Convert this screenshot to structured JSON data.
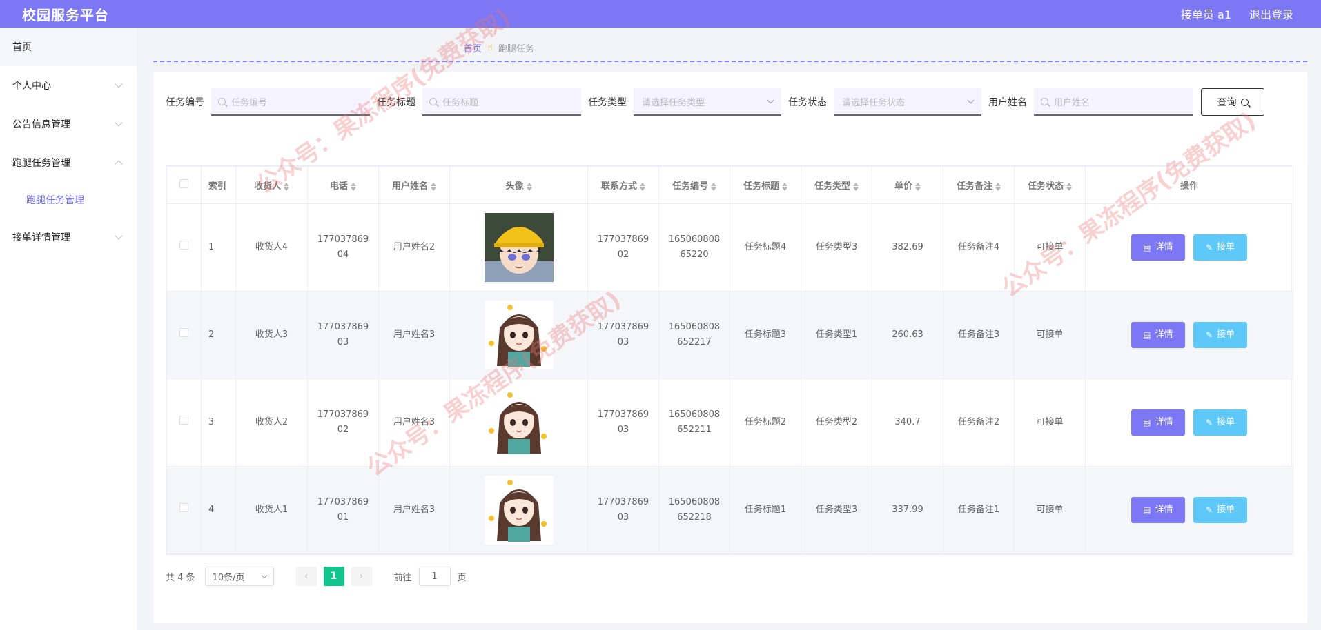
{
  "header": {
    "brand": "校园服务平台",
    "user_label": "接单员 a1",
    "logout": "退出登录"
  },
  "sidebar": {
    "items": [
      {
        "label": "首页"
      },
      {
        "label": "个人中心"
      },
      {
        "label": "公告信息管理"
      },
      {
        "label": "跑腿任务管理"
      },
      {
        "label": "跑腿任务管理"
      },
      {
        "label": "接单详情管理"
      }
    ]
  },
  "breadcrumb": {
    "home": "首页",
    "current": "跑腿任务"
  },
  "search": {
    "task_no_label": "任务编号",
    "task_no_placeholder": "任务编号",
    "task_title_label": "任务标题",
    "task_title_placeholder": "任务标题",
    "task_type_label": "任务类型",
    "task_type_placeholder": "请选择任务类型",
    "task_status_label": "任务状态",
    "task_status_placeholder": "请选择任务状态",
    "user_name_label": "用户姓名",
    "user_name_placeholder": "用户姓名",
    "query_button": "查询"
  },
  "table": {
    "headers": {
      "index": "索引",
      "receiver": "收货人",
      "phone": "电话",
      "user_name": "用户姓名",
      "avatar": "头像",
      "contact": "联系方式",
      "task_no": "任务编号",
      "task_title": "任务标题",
      "task_type": "任务类型",
      "price": "单价",
      "remark": "任务备注",
      "status": "任务状态",
      "actions": "操作"
    },
    "rows": [
      {
        "index": "1",
        "receiver": "收货人4",
        "phone": "177037869 04",
        "user_name": "用户姓名2",
        "avatar": "boy-avatar",
        "contact": "177037869 02",
        "task_no": "165060808 65220",
        "task_title": "任务标题4",
        "task_type": "任务类型3",
        "price": "382.69",
        "remark": "任务备注4",
        "status": "可接单"
      },
      {
        "index": "2",
        "receiver": "收货人3",
        "phone": "177037869 03",
        "user_name": "用户姓名3",
        "avatar": "girl-avatar",
        "contact": "177037869 03",
        "task_no": "165060808 652217",
        "task_title": "任务标题3",
        "task_type": "任务类型1",
        "price": "260.63",
        "remark": "任务备注3",
        "status": "可接单"
      },
      {
        "index": "3",
        "receiver": "收货人2",
        "phone": "177037869 02",
        "user_name": "用户姓名3",
        "avatar": "girl-avatar",
        "contact": "177037869 03",
        "task_no": "165060808 652211",
        "task_title": "任务标题2",
        "task_type": "任务类型2",
        "price": "340.7",
        "remark": "任务备注2",
        "status": "可接单"
      },
      {
        "index": "4",
        "receiver": "收货人1",
        "phone": "177037869 01",
        "user_name": "用户姓名3",
        "avatar": "girl-avatar",
        "contact": "177037869 03",
        "task_no": "165060808 652218",
        "task_title": "任务标题1",
        "task_type": "任务类型3",
        "price": "337.99",
        "remark": "任务备注1",
        "status": "可接单"
      }
    ],
    "detail_button": "详情",
    "take_button": "接单"
  },
  "pagination": {
    "total": "共 4 条",
    "page_size": "10条/页",
    "current_page": "1",
    "goto_label": "前往",
    "goto_value": "1",
    "page_suffix": "页"
  },
  "watermark": "公众号：果冻程序(免费获取)",
  "colors": {
    "primary": "#7b77f5",
    "take_button": "#5ec9f8",
    "page_active": "#13c58c"
  }
}
